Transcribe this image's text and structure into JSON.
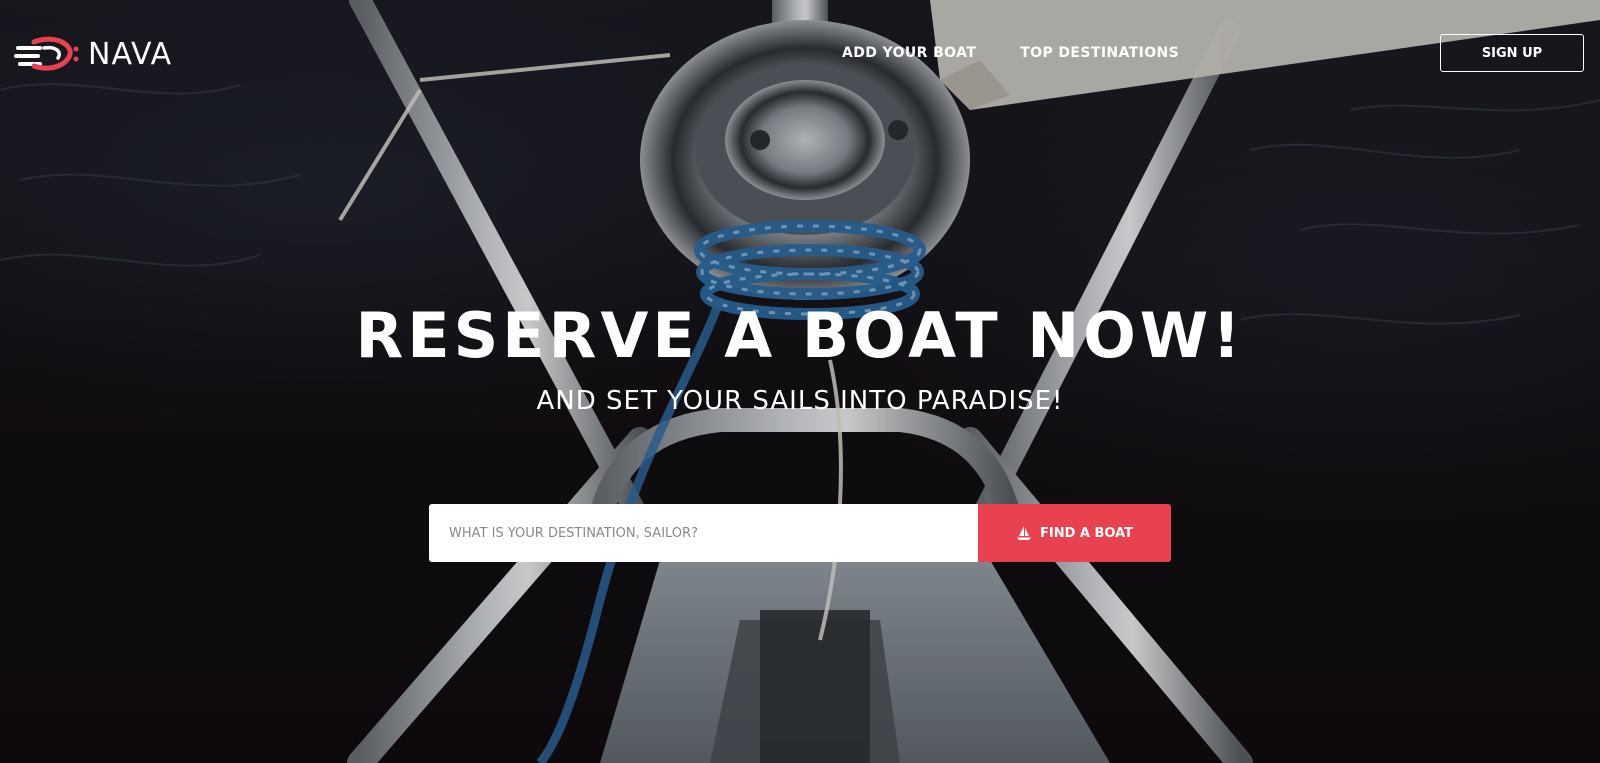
{
  "brand": {
    "name": "NAVA",
    "accent_color": "#e8414f"
  },
  "nav": {
    "items": [
      {
        "label": "ADD YOUR BOAT"
      },
      {
        "label": "TOP DESTINATIONS"
      }
    ],
    "signup_label": "SIGN UP"
  },
  "hero": {
    "headline": "RESERVE A BOAT NOW!",
    "subheadline": "AND SET YOUR SAILS INTO PARADISE!"
  },
  "search": {
    "placeholder": "WHAT IS YOUR DESTINATION, SAILOR?",
    "value": "",
    "button_label": "FIND A BOAT",
    "button_icon": "sailboat-icon",
    "button_color": "#e8414f"
  }
}
